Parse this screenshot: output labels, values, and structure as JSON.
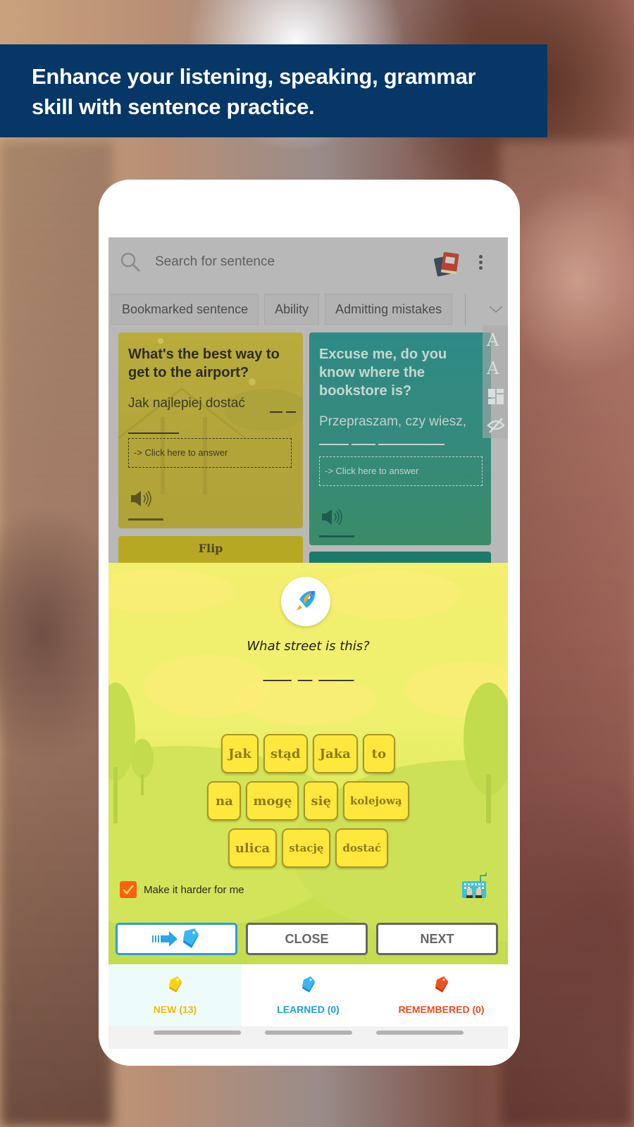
{
  "banner": {
    "line1": "Enhance your listening, speaking, grammar",
    "line2": "skill with sentence practice."
  },
  "app": {
    "search": {
      "placeholder": "Search for sentence",
      "icon": "search-icon"
    },
    "header_icons": [
      "book-icon",
      "more-vert-icon"
    ],
    "categories": [
      "Bookmarked sentence",
      "Ability",
      "Admitting mistakes"
    ],
    "cards": [
      {
        "question": "What's the best way to get to  the airport?",
        "answer": "Jak najlepiej dostać",
        "answer_prompt": "-> Click here to answer",
        "color": "#b9ac3c"
      },
      {
        "question": "Excuse me, do you know where  the bookstore is?",
        "answer": "Przepraszam, czy wiesz,",
        "answer_prompt": "-> Click here to answer",
        "color": "#2f8a86"
      }
    ],
    "flip_label": "Flip",
    "side_tools": [
      "font-increase-icon",
      "font-decrease-icon",
      "layout-icon",
      "hide-icon"
    ]
  },
  "practice": {
    "question": "What street is this?",
    "blanks": "____ __ _____",
    "word_rows": [
      [
        "Jak",
        "stąd",
        "Jaka",
        "to"
      ],
      [
        "na",
        "mogę",
        "się",
        "kolejową"
      ],
      [
        "ulica",
        "stację",
        "dostać"
      ]
    ],
    "harder_label": "Make it harder for me",
    "harder_checked": true,
    "buttons": {
      "move": "move-to-learned",
      "close": "CLOSE",
      "next": "NEXT"
    }
  },
  "tabs": [
    {
      "label": "NEW (13)",
      "color": "#f5b800",
      "active": true
    },
    {
      "label": "LEARNED (0)",
      "color": "#1c9ee6",
      "active": false
    },
    {
      "label": "REMEMBERED (0)",
      "color": "#ef4a1c",
      "active": false
    }
  ]
}
